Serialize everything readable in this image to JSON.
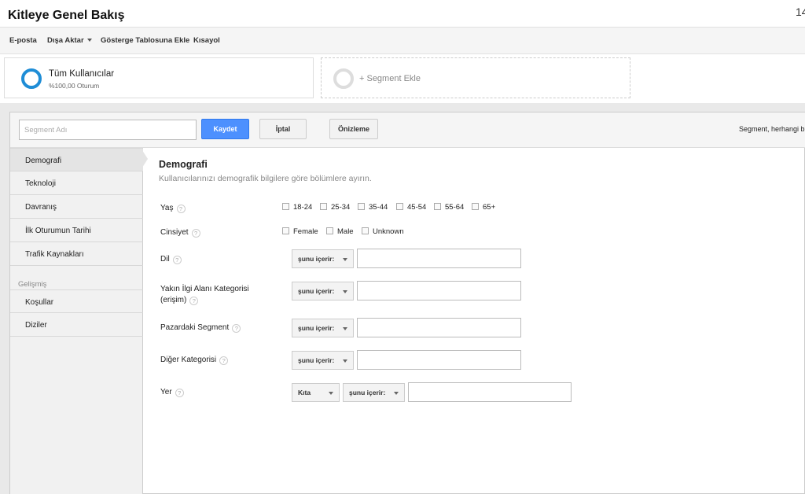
{
  "page": {
    "title": "Kitleye Genel Bakış",
    "corner_text": "14"
  },
  "actions": {
    "email": "E-posta",
    "export": "Dışa Aktar",
    "add_dashboard": "Gösterge Tablosuna Ekle",
    "shortcut": "Kısayol"
  },
  "segments": {
    "current": {
      "name": "Tüm Kullanıcılar",
      "sub": "%100,00 Oturum"
    },
    "add_label": "+ Segment Ekle"
  },
  "editor": {
    "segment_name_placeholder": "Segment Adı",
    "save_label": "Kaydet",
    "cancel_label": "İptal",
    "preview_label": "Önizleme",
    "note": "Segment, herhangi b",
    "primary_color": "#4d90fe"
  },
  "sidebar": {
    "items": [
      {
        "label": "Demografi",
        "active": true
      },
      {
        "label": "Teknoloji"
      },
      {
        "label": "Davranış"
      },
      {
        "label": "İlk Oturumun Tarihi"
      },
      {
        "label": "Trafik Kaynakları"
      }
    ],
    "advanced_group": "Gelişmiş",
    "advanced_items": [
      {
        "label": "Koşullar"
      },
      {
        "label": "Diziler"
      }
    ]
  },
  "content": {
    "heading": "Demografi",
    "description": "Kullanıcılarınızı demografik bilgilere göre bölümlere ayırın.",
    "help_glyph": "?",
    "age": {
      "label": "Yaş",
      "options": [
        "18-24",
        "25-34",
        "35-44",
        "45-54",
        "55-64",
        "65+"
      ]
    },
    "gender": {
      "label": "Cinsiyet",
      "options": [
        "Female",
        "Male",
        "Unknown"
      ]
    },
    "language": {
      "label": "Dil",
      "operator": "şunu içerir:"
    },
    "affinity": {
      "label_line1": "Yakın İlgi Alanı Kategorisi",
      "label_line2": "(erişim)",
      "operator": "şunu içerir:"
    },
    "in_market": {
      "label": "Pazardaki Segment",
      "operator": "şunu içerir:"
    },
    "other": {
      "label": "Diğer Kategorisi",
      "operator": "şunu içerir:"
    },
    "location": {
      "label": "Yer",
      "scope": "Kıta",
      "operator": "şunu içerir:"
    }
  }
}
